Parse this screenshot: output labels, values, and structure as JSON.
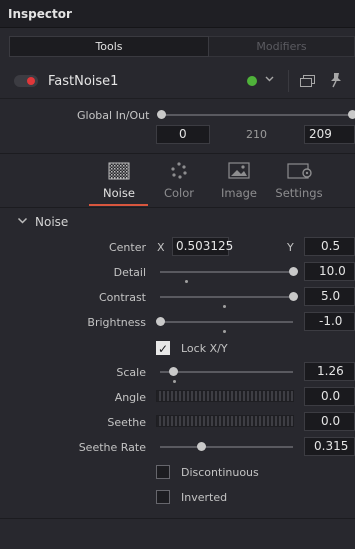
{
  "header": {
    "title": "Inspector"
  },
  "tabs": [
    {
      "label": "Tools"
    },
    {
      "label": "Modifiers"
    }
  ],
  "node": {
    "name": "FastNoise1",
    "status_color": "#4fb23a",
    "toggle_color": "#e0373a"
  },
  "global_in_out": {
    "label": "Global In/Out",
    "in_value": "0",
    "mid_value": "210",
    "out_value": "209"
  },
  "subtabs": [
    {
      "label": "Noise",
      "icon": "noise-icon",
      "active": true
    },
    {
      "label": "Color",
      "icon": "color-icon",
      "active": false
    },
    {
      "label": "Image",
      "icon": "image-icon",
      "active": false
    },
    {
      "label": "Settings",
      "icon": "settings-icon",
      "active": false
    }
  ],
  "section": {
    "title": "Noise"
  },
  "params": {
    "center": {
      "label": "Center",
      "x_label": "X",
      "x_value": "0.503125",
      "y_label": "Y",
      "y_value": "0.5"
    },
    "detail": {
      "label": "Detail",
      "value": "10.0",
      "fraction": 1.0
    },
    "contrast": {
      "label": "Contrast",
      "value": "5.0",
      "fraction": 1.0
    },
    "brightness": {
      "label": "Brightness",
      "value": "-1.0",
      "fraction": 0.0
    },
    "lock_xy": {
      "label": "Lock X/Y",
      "checked": true
    },
    "scale": {
      "label": "Scale",
      "value": "1.26",
      "fraction": 0.1
    },
    "angle": {
      "label": "Angle",
      "value": "0.0"
    },
    "seethe": {
      "label": "Seethe",
      "value": "0.0"
    },
    "seethe_rate": {
      "label": "Seethe Rate",
      "value": "0.315",
      "fraction": 0.315
    },
    "discontinuous": {
      "label": "Discontinuous",
      "checked": false
    },
    "inverted": {
      "label": "Inverted",
      "checked": false
    }
  },
  "accent_color": "#d8563e"
}
